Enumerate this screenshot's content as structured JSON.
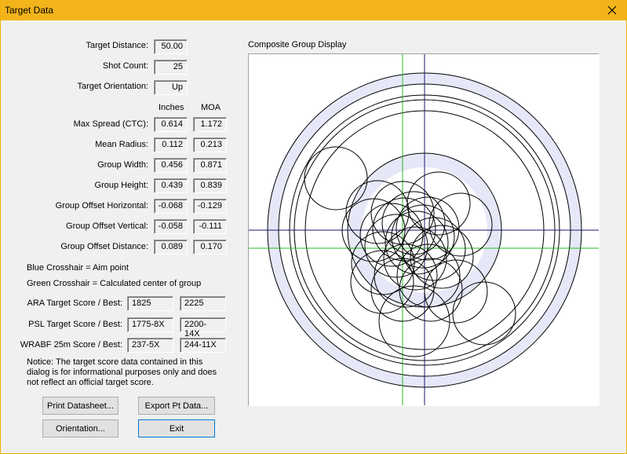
{
  "window": {
    "title": "Target Data"
  },
  "stats": {
    "target_distance_label": "Target Distance:",
    "target_distance": "50.00",
    "shot_count_label": "Shot Count:",
    "shot_count": "25",
    "orientation_label": "Target Orientation:",
    "orientation": "Up",
    "col_inches": "Inches",
    "col_moa": "MOA",
    "rows": [
      {
        "label": "Max Spread (CTC):",
        "inches": "0.614",
        "moa": "1.172"
      },
      {
        "label": "Mean Radius:",
        "inches": "0.112",
        "moa": "0.213"
      },
      {
        "label": "Group Width:",
        "inches": "0.456",
        "moa": "0.871"
      },
      {
        "label": "Group Height:",
        "inches": "0.439",
        "moa": "0.839"
      },
      {
        "label": "Group Offset Horizontal:",
        "inches": "-0.068",
        "moa": "-0.129"
      },
      {
        "label": "Group Offset Vertical:",
        "inches": "-0.058",
        "moa": "-0.111"
      },
      {
        "label": "Group Offset Distance:",
        "inches": "0.089",
        "moa": "0.170"
      }
    ]
  },
  "legend": {
    "blue": "Blue Crosshair = Aim point",
    "green": "Green Crosshair = Calculated center of group"
  },
  "scores": [
    {
      "label": "ARA Target Score / Best:",
      "score": "1825",
      "best": "2225"
    },
    {
      "label": "PSL Target Score / Best:",
      "score": "1775-8X",
      "best": "2200-14X"
    },
    {
      "label": "WRABF 25m Score / Best:",
      "score": "237-5X",
      "best": "244-11X"
    }
  ],
  "notice": [
    "Notice: The target score data contained in this",
    "dialog is for informational purposes only and does",
    "not reflect an official target score."
  ],
  "buttons": {
    "print": "Print Datasheet...",
    "export": "Export Pt Data...",
    "orientation": "Orientation...",
    "exit": "Exit"
  },
  "display": {
    "title": "Composite Group Display",
    "aim_color": "#1a1a6e",
    "center_color": "#22bb22",
    "ring_fill_color": "#e6e8f8"
  }
}
